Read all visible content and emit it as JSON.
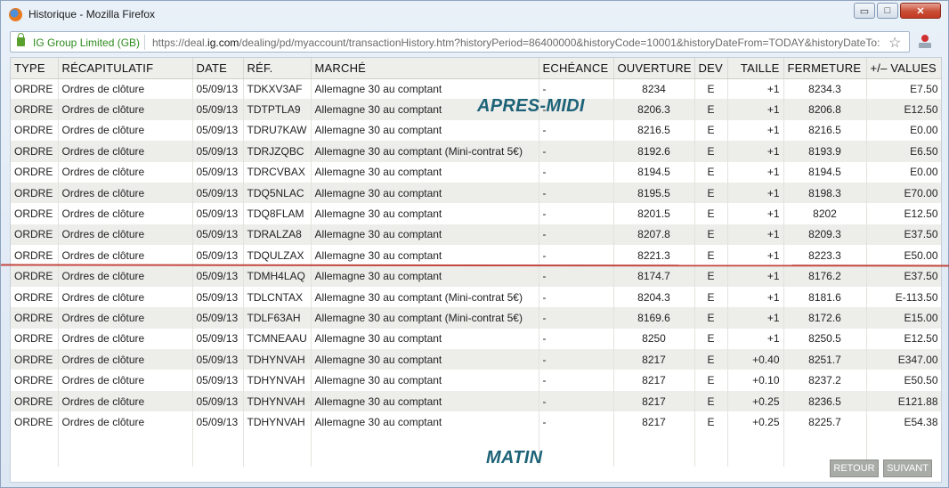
{
  "window": {
    "title": "Historique - Mozilla Firefox",
    "identity": "IG Group Limited (GB)",
    "url_prefix": "https://deal.",
    "url_domain": "ig.com",
    "url_rest": "/dealing/pd/myaccount/transactionHistory.htm?historyPeriod=86400000&historyCode=10001&historyDateFrom=TODAY&historyDateTo:",
    "minimize": "▭",
    "maximize": "□",
    "close": "✕",
    "star_glyph": "☆"
  },
  "table": {
    "headers": [
      "TYPE",
      "RÉCAPITULATIF",
      "DATE",
      "RÉF.",
      "MARCHÉ",
      "ECHÉANCE",
      "OUVERTURE",
      "DEV",
      "TAILLE",
      "FERMETURE",
      "+/– VALUES"
    ],
    "rows": [
      [
        "ORDRE",
        "Ordres de clôture",
        "05/09/13",
        "TDKXV3AF",
        "Allemagne 30 au comptant",
        "-",
        "8234",
        "E",
        "+1",
        "8234.3",
        "E7.50"
      ],
      [
        "ORDRE",
        "Ordres de clôture",
        "05/09/13",
        "TDTPTLA9",
        "Allemagne 30 au comptant",
        "-",
        "8206.3",
        "E",
        "+1",
        "8206.8",
        "E12.50"
      ],
      [
        "ORDRE",
        "Ordres de clôture",
        "05/09/13",
        "TDRU7KAW",
        "Allemagne 30 au comptant",
        "-",
        "8216.5",
        "E",
        "+1",
        "8216.5",
        "E0.00"
      ],
      [
        "ORDRE",
        "Ordres de clôture",
        "05/09/13",
        "TDRJZQBC",
        "Allemagne 30 au comptant (Mini-contrat 5€)",
        "-",
        "8192.6",
        "E",
        "+1",
        "8193.9",
        "E6.50"
      ],
      [
        "ORDRE",
        "Ordres de clôture",
        "05/09/13",
        "TDRCVBAX",
        "Allemagne 30 au comptant",
        "-",
        "8194.5",
        "E",
        "+1",
        "8194.5",
        "E0.00"
      ],
      [
        "ORDRE",
        "Ordres de clôture",
        "05/09/13",
        "TDQ5NLAC",
        "Allemagne 30 au comptant",
        "-",
        "8195.5",
        "E",
        "+1",
        "8198.3",
        "E70.00"
      ],
      [
        "ORDRE",
        "Ordres de clôture",
        "05/09/13",
        "TDQ8FLAM",
        "Allemagne 30 au comptant",
        "-",
        "8201.5",
        "E",
        "+1",
        "8202",
        "E12.50"
      ],
      [
        "ORDRE",
        "Ordres de clôture",
        "05/09/13",
        "TDRALZA8",
        "Allemagne 30 au comptant",
        "-",
        "8207.8",
        "E",
        "+1",
        "8209.3",
        "E37.50"
      ],
      [
        "ORDRE",
        "Ordres de clôture",
        "05/09/13",
        "TDQULZAX",
        "Allemagne 30 au comptant",
        "-",
        "8221.3",
        "E",
        "+1",
        "8223.3",
        "E50.00"
      ],
      [
        "ORDRE",
        "Ordres de clôture",
        "05/09/13",
        "TDMH4LAQ",
        "Allemagne 30 au comptant",
        "-",
        "8174.7",
        "E",
        "+1",
        "8176.2",
        "E37.50"
      ],
      [
        "ORDRE",
        "Ordres de clôture",
        "05/09/13",
        "TDLCNTAX",
        "Allemagne 30 au comptant (Mini-contrat 5€)",
        "-",
        "8204.3",
        "E",
        "+1",
        "8181.6",
        "E-113.50"
      ],
      [
        "ORDRE",
        "Ordres de clôture",
        "05/09/13",
        "TDLF63AH",
        "Allemagne 30 au comptant (Mini-contrat 5€)",
        "-",
        "8169.6",
        "E",
        "+1",
        "8172.6",
        "E15.00"
      ],
      [
        "ORDRE",
        "Ordres de clôture",
        "05/09/13",
        "TCMNEAAU",
        "Allemagne 30 au comptant",
        "-",
        "8250",
        "E",
        "+1",
        "8250.5",
        "E12.50"
      ],
      [
        "ORDRE",
        "Ordres de clôture",
        "05/09/13",
        "TDHYNVAH",
        "Allemagne 30 au comptant",
        "-",
        "8217",
        "E",
        "+0.40",
        "8251.7",
        "E347.00"
      ],
      [
        "ORDRE",
        "Ordres de clôture",
        "05/09/13",
        "TDHYNVAH",
        "Allemagne 30 au comptant",
        "-",
        "8217",
        "E",
        "+0.10",
        "8237.2",
        "E50.50"
      ],
      [
        "ORDRE",
        "Ordres de clôture",
        "05/09/13",
        "TDHYNVAH",
        "Allemagne 30 au comptant",
        "-",
        "8217",
        "E",
        "+0.25",
        "8236.5",
        "E121.88"
      ],
      [
        "ORDRE",
        "Ordres de clôture",
        "05/09/13",
        "TDHYNVAH",
        "Allemagne 30 au comptant",
        "-",
        "8217",
        "E",
        "+0.25",
        "8225.7",
        "E54.38"
      ]
    ]
  },
  "annotations": {
    "afternoon": "APRES-MIDI",
    "morning": "MATIN",
    "divider_color": "#c2463e"
  },
  "pager": {
    "back": "RETOUR",
    "next": "SUIVANT"
  }
}
